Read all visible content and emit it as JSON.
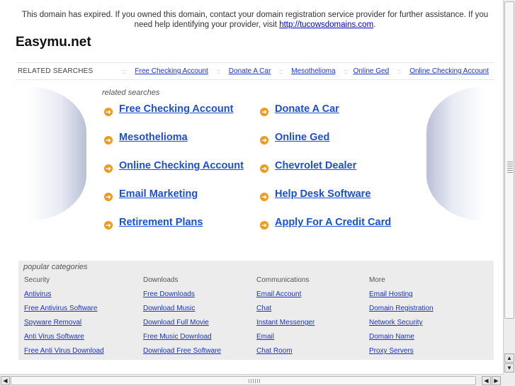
{
  "notice": {
    "text": "This domain has expired. If you owned this domain, contact your domain registration service provider for further assistance. If you need help identifying your provider, visit ",
    "link": "http://tucowsdomains.com",
    "end": "."
  },
  "site_title": "Easymu.net",
  "related_bar": {
    "label": "RELATED SEARCHES",
    "separator": "::",
    "links": [
      "Free Checking Account",
      "Donate A Car",
      "Mesothelioma",
      "Online Ged",
      "Online Checking Account"
    ]
  },
  "related_searches": {
    "heading": "related searches",
    "links": [
      "Free Checking Account",
      "Donate A Car",
      "Mesothelioma",
      "Online Ged",
      "Online Checking Account",
      "Chevrolet Dealer",
      "Email Marketing",
      "Help Desk Software",
      "Retirement Plans",
      "Apply For A Credit Card"
    ]
  },
  "popular_categories": {
    "heading": "popular categories",
    "columns": [
      {
        "title": "Security",
        "links": [
          "Antivirus",
          "Free Antivirus Software",
          "Spyware Removal",
          "Anti Virus Software",
          "Free Anti Virus Download"
        ]
      },
      {
        "title": "Downloads",
        "links": [
          "Free Downloads",
          "Download Music",
          "Download Full Movie",
          "Free Music Download",
          "Download Free Software"
        ]
      },
      {
        "title": "Communications",
        "links": [
          "Email Account",
          "Chat",
          "Instant Messenger",
          "Email",
          "Chat Room"
        ]
      },
      {
        "title": "More",
        "links": [
          "Email Hosting",
          "Domain Registration",
          "Network Security",
          "Domain Name",
          "Proxy Servers"
        ]
      }
    ]
  },
  "icons": {
    "bullet": "orange-circle-arrow-icon",
    "scroll_up": "arrow-up-icon",
    "scroll_down": "arrow-down-icon",
    "scroll_left": "arrow-left-icon",
    "scroll_right": "arrow-right-icon"
  },
  "colors": {
    "link": "#1a4fd6",
    "bullet": "#f29a1d",
    "panel": "#ececec"
  }
}
